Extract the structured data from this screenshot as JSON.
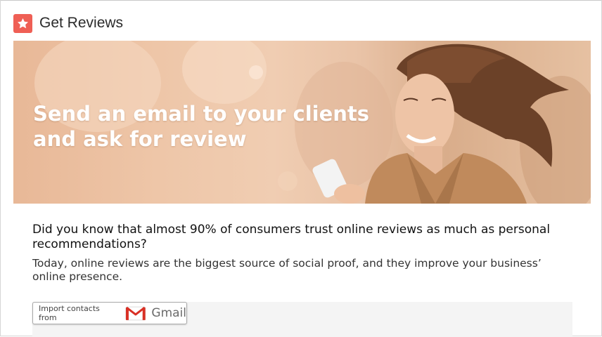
{
  "header": {
    "title": "Get Reviews",
    "icon": "star-icon",
    "icon_color": "#ef5f55"
  },
  "banner": {
    "line1": "Send an email to your clients",
    "line2": "and ask for review",
    "image": "woman-with-phone-photo"
  },
  "content": {
    "question": "Did you know that almost 90% of consumers trust online reviews as much as personal recommendations?",
    "description": "Today, online reviews are the biggest source of social proof, and they improve your business’ online presence."
  },
  "import": {
    "label": "Import contacts from",
    "provider": "Gmail",
    "provider_icon": "gmail-icon"
  },
  "colors": {
    "accent": "#ef5f55",
    "gmail_red": "#d93025"
  }
}
